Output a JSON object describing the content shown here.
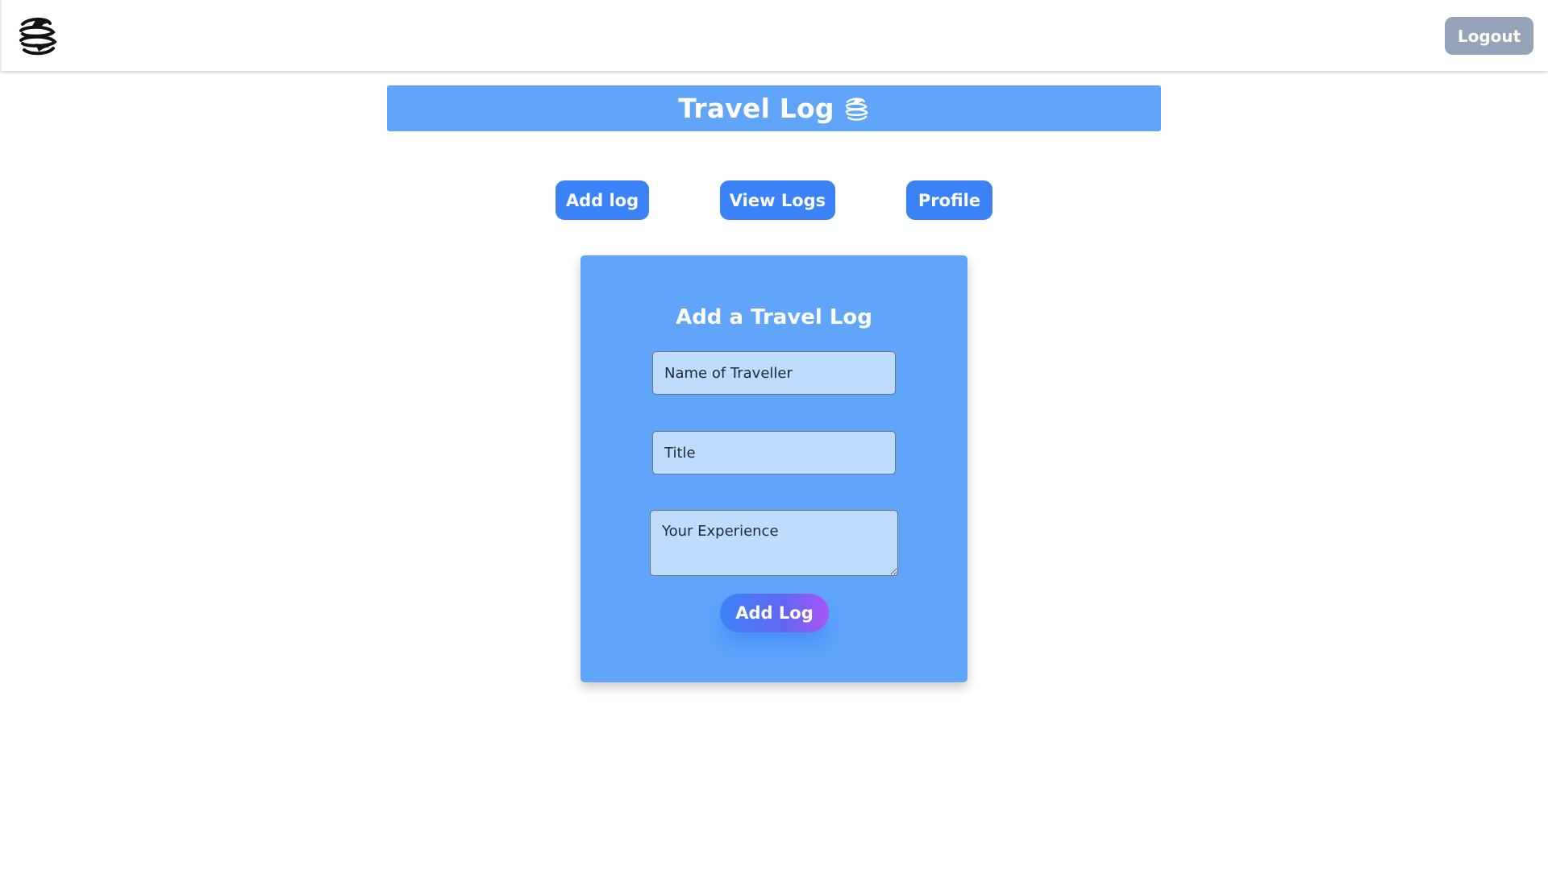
{
  "header": {
    "logo_icon": "globe-plane-logo-icon",
    "logout_label": "Logout"
  },
  "banner": {
    "title": "Travel Log",
    "icon": "globe-plane-icon"
  },
  "nav": {
    "add_log_label": "Add log",
    "view_logs_label": "View Logs",
    "profile_label": "Profile"
  },
  "form": {
    "heading": "Add a Travel Log",
    "name_placeholder": "Name of Traveller",
    "title_placeholder": "Title",
    "experience_placeholder": "Your Experience",
    "submit_label": "Add Log"
  },
  "colors": {
    "primary_blue": "#3b82f6",
    "panel_blue": "#60a5fa",
    "input_blue": "#bfdbfe",
    "logout_gray": "#94a3b8",
    "gradient_end_purple": "#a855f7"
  }
}
